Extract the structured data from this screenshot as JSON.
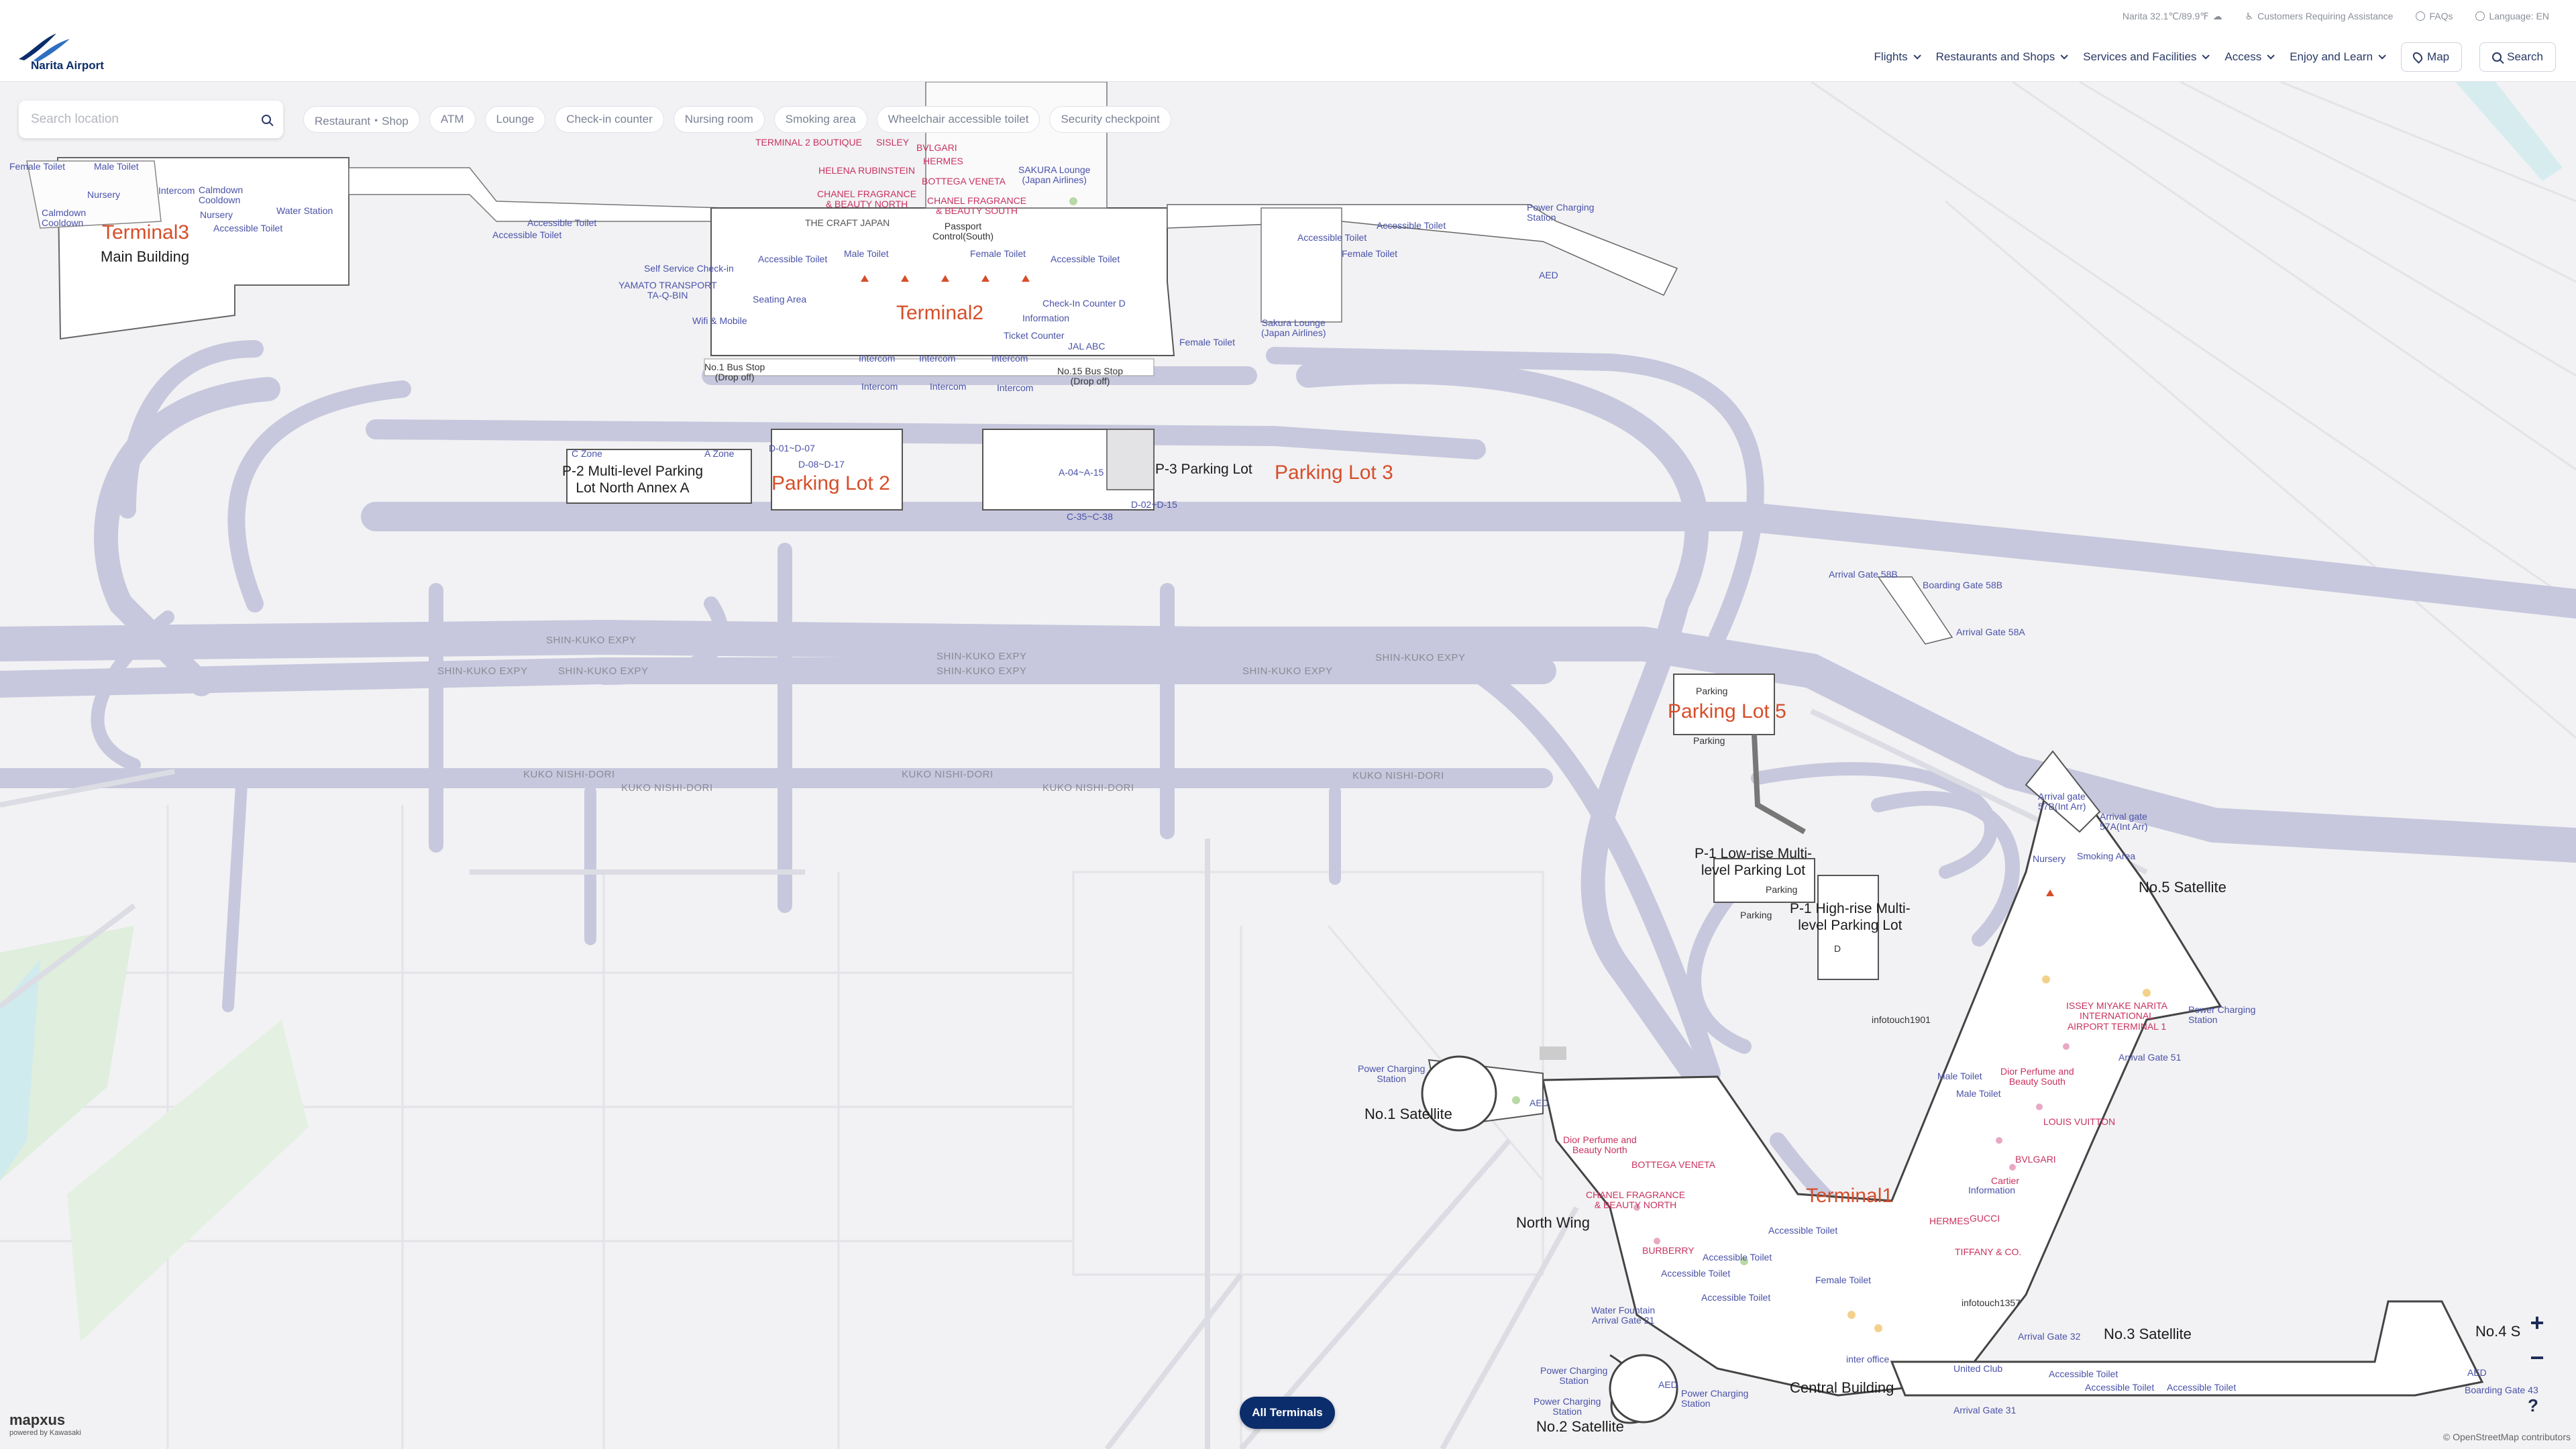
{
  "header": {
    "logo_text": "Narita Airport",
    "weather": "Narita 32.1℃/89.9℉",
    "assistance": "Customers Requiring Assistance",
    "faqs": "FAQs",
    "language": "Language: EN",
    "nav": [
      "Flights",
      "Restaurants and Shops",
      "Services and Facilities",
      "Access",
      "Enjoy and Learn"
    ],
    "map_button": "Map",
    "search_button": "Search"
  },
  "search": {
    "placeholder": "Search location"
  },
  "filters": [
    "Restaurant・Shop",
    "ATM",
    "Lounge",
    "Check-in counter",
    "Nursing room",
    "Smoking area",
    "Wheelchair accessible toilet",
    "Security checkpoint"
  ],
  "map_labels": {
    "terminal3": "Terminal3",
    "t3_main": "Main Building",
    "terminal2": "Terminal2",
    "terminal1": "Terminal1",
    "parking2": "Parking Lot 2",
    "parking3": "Parking Lot 3",
    "parking5": "Parking Lot 5",
    "p2_annex": "P-2 Multi-level Parking\nLot North Annex A",
    "p3_lot": "P-3 Parking Lot",
    "p1_low": "P-1 Low-rise Multi-\nlevel Parking Lot",
    "p1_high": "P-1 High-rise Multi-\nlevel Parking Lot",
    "no1_sat": "No.1 Satellite",
    "no2_sat": "No.2 Satellite",
    "no3_sat": "No.3 Satellite",
    "no4_sat": "No.4 S",
    "no5_sat": "No.5 Satellite",
    "north_wing": "North Wing",
    "central_building": "Central Building",
    "road_shinkuko": "SHIN-KUKO EXPY",
    "road_kuko_nishi": "KUKO NISHI-DORI",
    "female_toilet": "Female Toilet",
    "male_toilet": "Male Toilet",
    "accessible_toilet": "Accessible Toilet",
    "intercom": "Intercom",
    "nursery": "Nursery",
    "water_station": "Water Station",
    "calmdown": "Calmdown\nCooldown",
    "self_service": "Self Service Check-in",
    "yamato": "YAMATO TRANSPORT\nTA-Q-BIN",
    "wifi": "Wifi & Mobile",
    "seating": "Seating Area",
    "the_craft": "THE CRAFT JAPAN",
    "passport": "Passport\nControl(South)",
    "checkin_counter": "Check-In Counter D",
    "information": "Information",
    "ticket_counter": "Ticket Counter",
    "jal_abc": "JAL ABC",
    "bus_stop1": "No.1 Bus Stop\n(Drop off)",
    "bus_stop15": "No.15 Bus Stop\n(Drop off)",
    "sakura_lounge": "SAKURA Lounge\n(Japan Airlines)",
    "sakura_lounge2": "Sakura Lounge\n(Japan Airlines)",
    "power_charging": "Power Charging\nStation",
    "aed": "AED",
    "helena": "HELENA RUBINSTEIN",
    "chanel_n": "CHANEL FRAGRANCE\n& BEAUTY NORTH",
    "chanel_s": "CHANEL FRAGRANCE\n& BEAUTY SOUTH",
    "bottega": "BOTTEGA VENETA",
    "hermes": "HERMES",
    "bvlgari": "BVLGARI",
    "sisley": "SISLEY",
    "t2_boutique": "TERMINAL 2 BOUTIQUE",
    "arrival_58b": "Arrival Gate 58B",
    "boarding_58b": "Boarding Gate 58B",
    "arrival_58a": "Arrival Gate 58A",
    "arrival_57b": "Arrival gate\n57B(Int Arr)",
    "arrival_57a": "Arrival gate\n57A(Int Arr)",
    "parking": "Parking",
    "smoking": "Smoking Area",
    "infotouch1901": "infotouch1901",
    "infotouch1357": "infotouch1357",
    "issey": "ISSEY MIYAKE NARITA\nINTERNATIONAL\nAIRPORT TERMINAL 1",
    "arrival_51": "Arrival Gate 51",
    "dior_s": "Dior Perfume and\nBeauty South",
    "dior_n": "Dior Perfume and\nBeauty North",
    "louis": "LOUIS VUITTON",
    "cartier": "Cartier",
    "gucci": "GUCCI",
    "tiffany": "TIFFANY & CO.",
    "burberry": "BURBERRY",
    "water_fountain": "Water Fountain\nArrival Gate 21",
    "arrival_32": "Arrival Gate 32",
    "arrival_31": "Arrival Gate 31",
    "boarding_43": "Boarding Gate 43",
    "united_club": "United Club",
    "inter_office": "inter office",
    "c_zone": "C Zone",
    "a_zone": "A Zone",
    "d_range1": "D-01~D-07",
    "d_range2": "D-08~D-17",
    "a_range": "A-04~A-15",
    "c_range": "C-35~C-38",
    "d_range3": "D-02~D-15",
    "d_single": "D"
  },
  "all_terminals": "All Terminals",
  "mapxus": {
    "brand": "mapxus",
    "sub": "powered by Kawasaki"
  },
  "attribution": "© OpenStreetMap contributors",
  "zoom_in": "+",
  "zoom_out": "−",
  "help": "?"
}
